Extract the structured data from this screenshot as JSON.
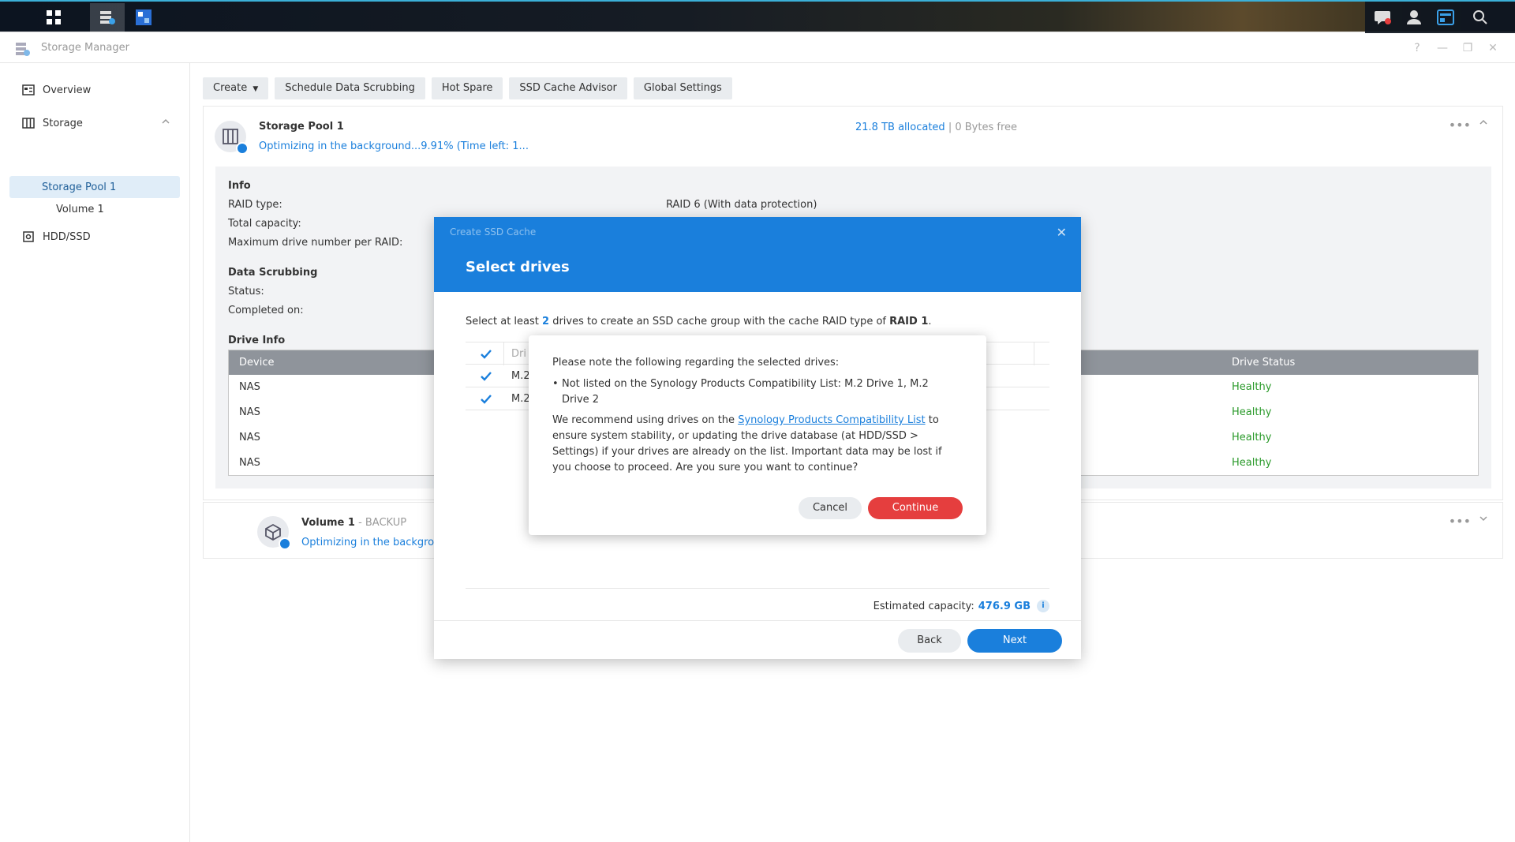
{
  "app": {
    "title": "Storage Manager"
  },
  "window_controls": {
    "help": "?",
    "minimize": "—",
    "restore": "❐",
    "close": "✕"
  },
  "sidebar": {
    "items": [
      {
        "label": "Overview"
      },
      {
        "label": "Storage"
      },
      {
        "label": "Storage Pool 1"
      },
      {
        "label": "Volume 1"
      },
      {
        "label": "HDD/SSD"
      }
    ]
  },
  "toolbar": {
    "create": "Create",
    "schedule": "Schedule Data Scrubbing",
    "hot_spare": "Hot Spare",
    "ssd_advisor": "SSD Cache Advisor",
    "global_settings": "Global Settings"
  },
  "pool": {
    "name": "Storage Pool 1",
    "status": "Optimizing in the background...9.91% (Time left: 1...",
    "allocated": "21.8 TB allocated",
    "separator": "|",
    "free": "0 Bytes free",
    "info_title": "Info",
    "raid_type_label": "RAID type:",
    "raid_type_value": "RAID 6 (With data protection)",
    "total_capacity_label": "Total capacity:",
    "max_drive_label": "Maximum drive number per RAID:",
    "scrub_title": "Data Scrubbing",
    "status_label": "Status:",
    "completed_label": "Completed on:",
    "drive_info_title": "Drive Info",
    "drive_table": {
      "headers": {
        "device": "Device",
        "status": "Drive Status"
      },
      "rows": [
        {
          "device": "NAS",
          "status": "Healthy"
        },
        {
          "device": "NAS",
          "status": "Healthy"
        },
        {
          "device": "NAS",
          "status": "Healthy"
        },
        {
          "device": "NAS",
          "status": "Healthy"
        }
      ]
    }
  },
  "volume": {
    "name": "Volume 1",
    "tag": " - BACKUP",
    "status": "Optimizing in the backgro"
  },
  "dialog": {
    "small_title": "Create SSD Cache",
    "title": "Select drives",
    "desc_pre": "Select at least ",
    "desc_num": "2",
    "desc_mid": " drives to create an SSD cache group with the cache RAID type of ",
    "desc_raid": "RAID 1",
    "desc_end": ".",
    "drive_header": "Dri",
    "drive_rows": [
      "M.2",
      "M.2"
    ],
    "estimated_label": "Estimated capacity:",
    "estimated_value": "476.9 GB",
    "info_glyph": "i",
    "back": "Back",
    "next": "Next"
  },
  "confirm": {
    "title": "Please note the following regarding the selected drives:",
    "bullet": "Not listed on the Synology Products Compatibility List: M.2 Drive 1, M.2 Drive 2",
    "body_pre": "We recommend using drives on the ",
    "link": "Synology Products Compatibility List",
    "body_post": " to ensure system stability, or updating the drive database (at HDD/SSD > Settings) if your drives are already on the list. Important data may be lost if you choose to proceed. Are you sure you want to continue?",
    "cancel": "Cancel",
    "continue": "Continue"
  },
  "colors": {
    "accent": "#1a7fdc",
    "danger": "#e53e3e",
    "healthy": "#2a9a2a"
  }
}
